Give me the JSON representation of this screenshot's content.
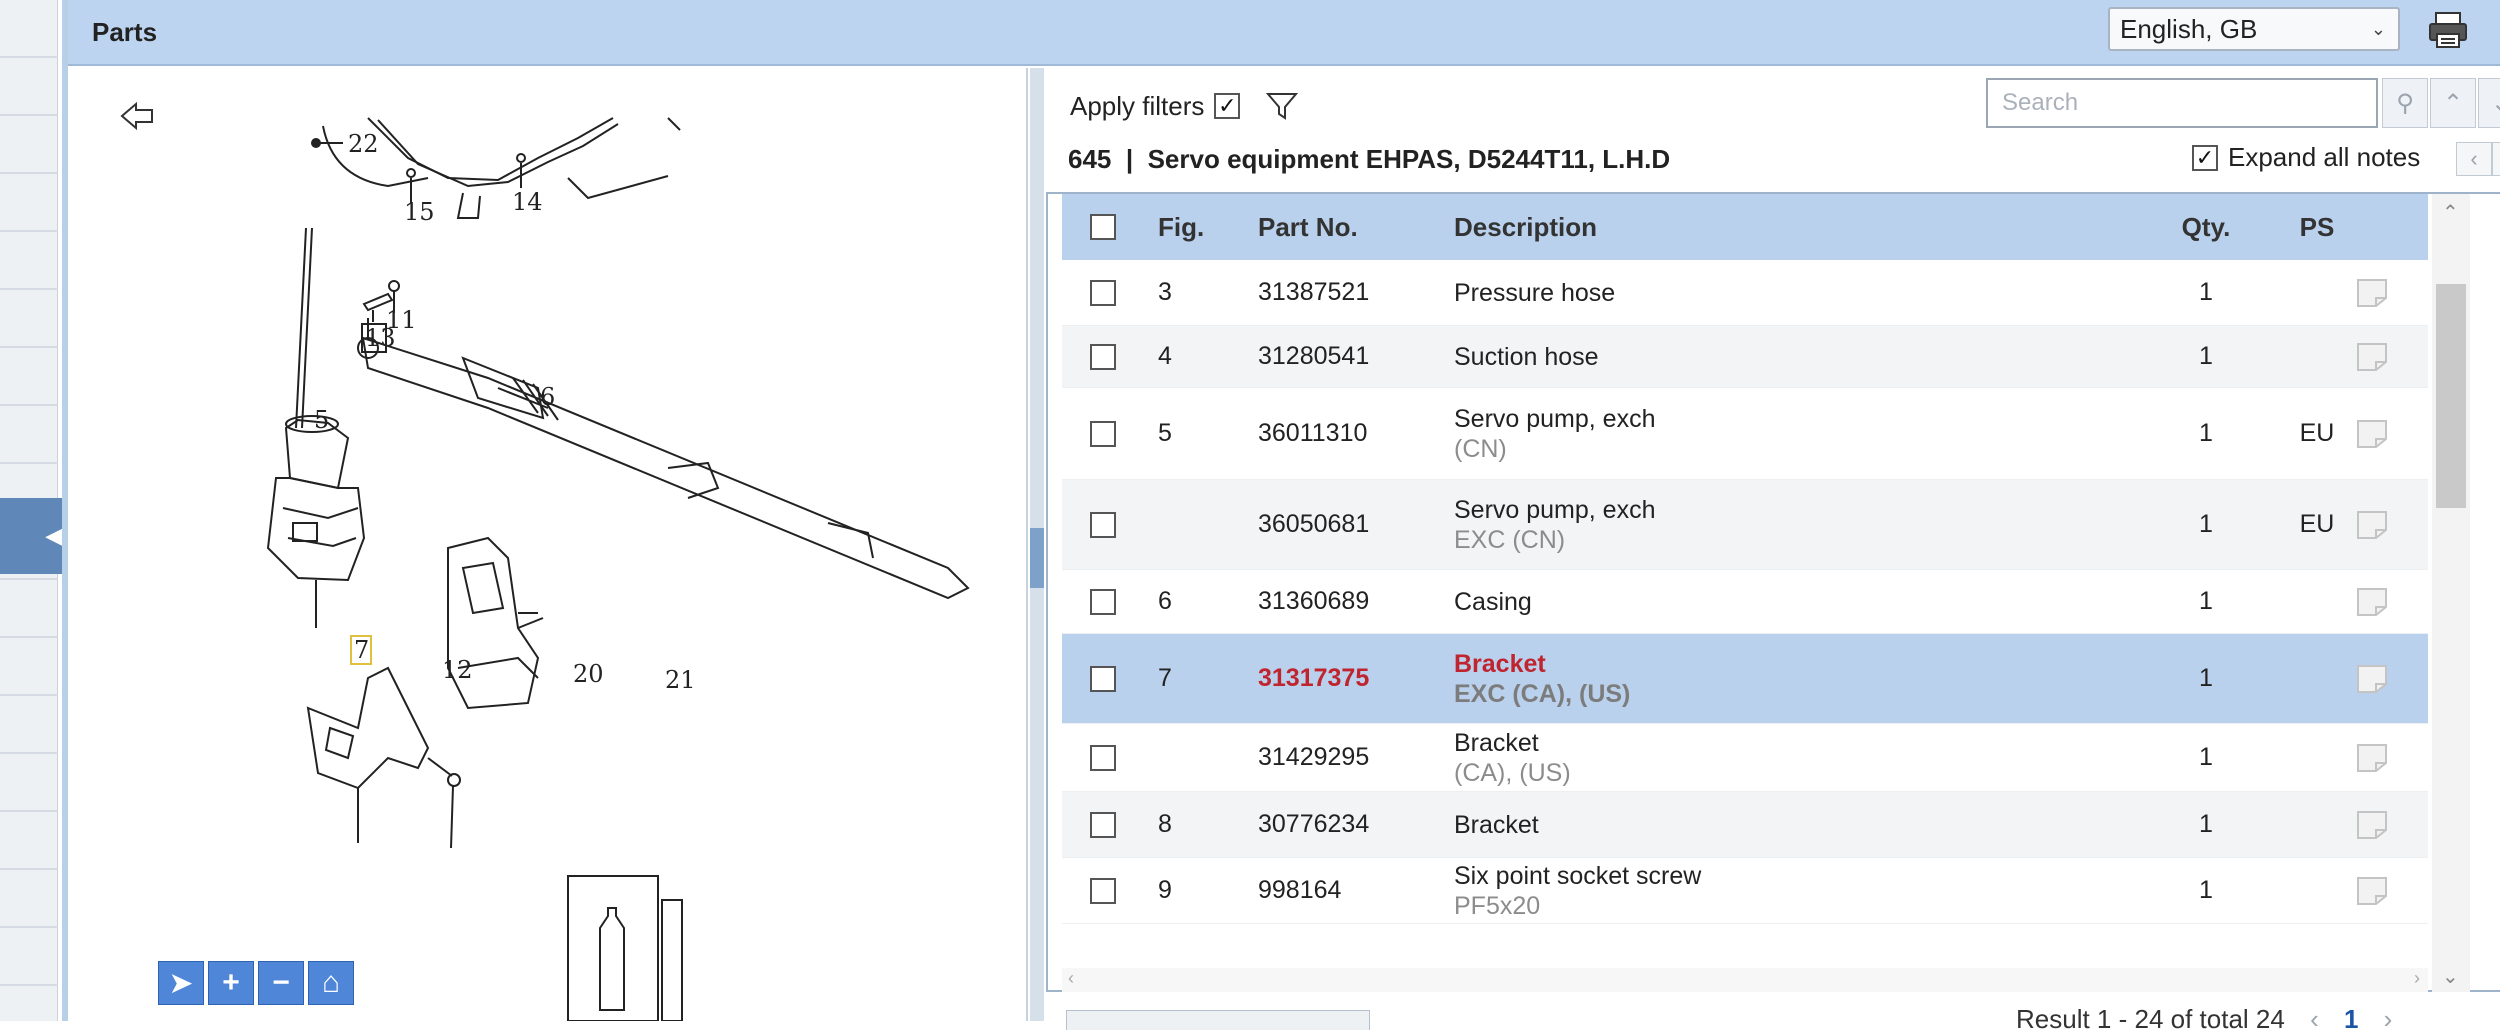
{
  "window": {
    "title": "Parts",
    "language": "English, GB"
  },
  "illustration": {
    "callouts": [
      "22",
      "15",
      "14",
      "11",
      "13",
      "5",
      "6",
      "7",
      "12",
      "20"
    ],
    "edge_label": "21"
  },
  "parts": {
    "apply_filters_label": "Apply filters",
    "apply_filters_checked": true,
    "search_placeholder": "Search",
    "group_number": "645",
    "group_separator": "|",
    "group_name": "Servo equipment EHPAS, D5244T11, L.H.D",
    "expand_notes_label": "Expand all notes",
    "expand_notes_checked": true,
    "columns": {
      "fig": "Fig.",
      "part_no": "Part No.",
      "description": "Description",
      "qty": "Qty.",
      "ps": "PS"
    },
    "rows": [
      {
        "fig": "3",
        "part_no": "31387521",
        "desc": "Pressure hose",
        "sub": "",
        "qty": "1",
        "ps": ""
      },
      {
        "fig": "4",
        "part_no": "31280541",
        "desc": "Suction hose",
        "sub": "",
        "qty": "1",
        "ps": ""
      },
      {
        "fig": "5",
        "part_no": "36011310",
        "desc": "Servo pump, exch",
        "sub": "(CN)",
        "qty": "1",
        "ps": "EU"
      },
      {
        "fig": "",
        "part_no": "36050681",
        "desc": "Servo pump, exch",
        "sub": "EXC (CN)",
        "qty": "1",
        "ps": "EU"
      },
      {
        "fig": "6",
        "part_no": "31360689",
        "desc": "Casing",
        "sub": "",
        "qty": "1",
        "ps": ""
      },
      {
        "fig": "7",
        "part_no": "31317375",
        "desc": "Bracket",
        "sub": "EXC (CA), (US)",
        "qty": "1",
        "ps": "",
        "selected": true
      },
      {
        "fig": "",
        "part_no": "31429295",
        "desc": "Bracket",
        "sub": "(CA), (US)",
        "qty": "1",
        "ps": ""
      },
      {
        "fig": "8",
        "part_no": "30776234",
        "desc": "Bracket",
        "sub": "",
        "qty": "1",
        "ps": ""
      },
      {
        "fig": "9",
        "part_no": "998164",
        "desc": "Six point socket screw",
        "sub": "PF5x20",
        "qty": "1",
        "ps": ""
      }
    ],
    "result_text": "Result 1 - 24 of total 24",
    "page_number": "1"
  },
  "colors": {
    "header_bg": "#bcd4ef",
    "selected_row": "#b9d1ec",
    "highlight_red": "#c0242e",
    "tool_blue": "#4f86d8"
  },
  "icons": [
    "back-arrow-icon",
    "print-icon",
    "filter-icon",
    "search-icon",
    "chevron-up-icon",
    "chevron-down-icon",
    "note-icon",
    "select-tool-icon",
    "zoom-in-icon",
    "zoom-out-icon",
    "home-icon"
  ]
}
